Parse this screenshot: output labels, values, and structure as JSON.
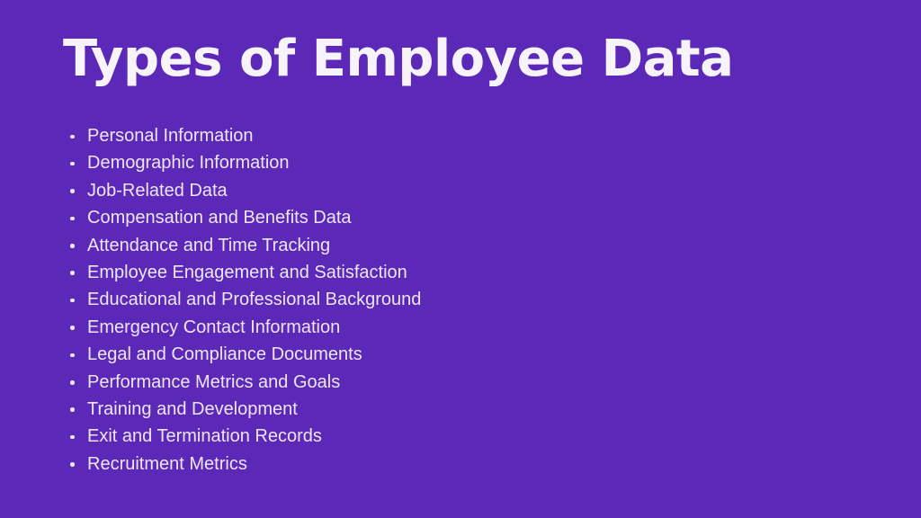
{
  "slide": {
    "background_color": "#5b28b7",
    "title": "Types of Employee Data",
    "title_color": "#f7f3fb",
    "body_text_color": "#eee6f6",
    "bullet_marker": "dot-bullet",
    "items": [
      {
        "label": "Personal Information"
      },
      {
        "label": "Demographic Information"
      },
      {
        "label": "Job-Related Data"
      },
      {
        "label": "Compensation and Benefits Data"
      },
      {
        "label": "Attendance and Time Tracking"
      },
      {
        "label": "Employee Engagement and Satisfaction"
      },
      {
        "label": "Educational and Professional Background"
      },
      {
        "label": "Emergency Contact Information"
      },
      {
        "label": "Legal and Compliance Documents"
      },
      {
        "label": "Performance Metrics and Goals"
      },
      {
        "label": "Training and Development"
      },
      {
        "label": "Exit and Termination Records"
      },
      {
        "label": "Recruitment Metrics"
      }
    ]
  }
}
